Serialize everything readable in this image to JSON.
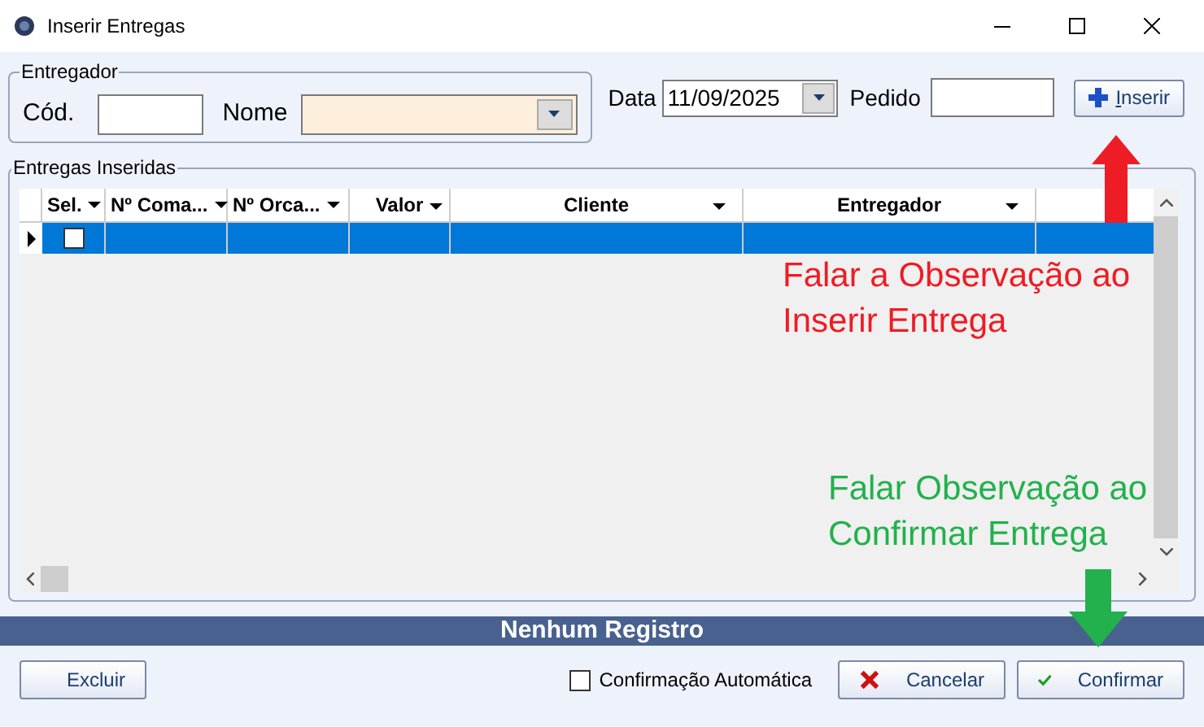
{
  "window": {
    "title": "Inserir Entregas"
  },
  "entregador": {
    "title": "Entregador",
    "cod_label": "Cód.",
    "nome_label": "Nome"
  },
  "data": {
    "label": "Data",
    "value": "11/09/2025"
  },
  "pedido": {
    "label": "Pedido"
  },
  "insert_button": {
    "label": "Inserir"
  },
  "grid": {
    "title": "Entregas Inseridas",
    "columns": [
      {
        "label": "Sel."
      },
      {
        "label": "Nº Coma..."
      },
      {
        "label": "Nº Orca..."
      },
      {
        "label": "Valor"
      },
      {
        "label": "Cliente"
      },
      {
        "label": "Entregador"
      }
    ],
    "rows": [
      {
        "selected": true,
        "checked": false
      }
    ]
  },
  "status_bar": "Nenhum Registro",
  "auto_confirm": {
    "label": "Confirmação Automática",
    "checked": false
  },
  "buttons": [
    {
      "label": "Excluir",
      "kind": "delete"
    },
    {
      "label": "Cancelar",
      "kind": "cancel"
    },
    {
      "label": "Confirmar",
      "kind": "confirm"
    }
  ],
  "annotations": [
    {
      "text": "Falar a Observação ao Inserir Entrega",
      "color": "#ee1c24",
      "kind": "up_arrow"
    },
    {
      "text": "Falar Observação ao Confirmar Entrega",
      "color": "#22b14c",
      "kind": "down_arrow"
    }
  ]
}
